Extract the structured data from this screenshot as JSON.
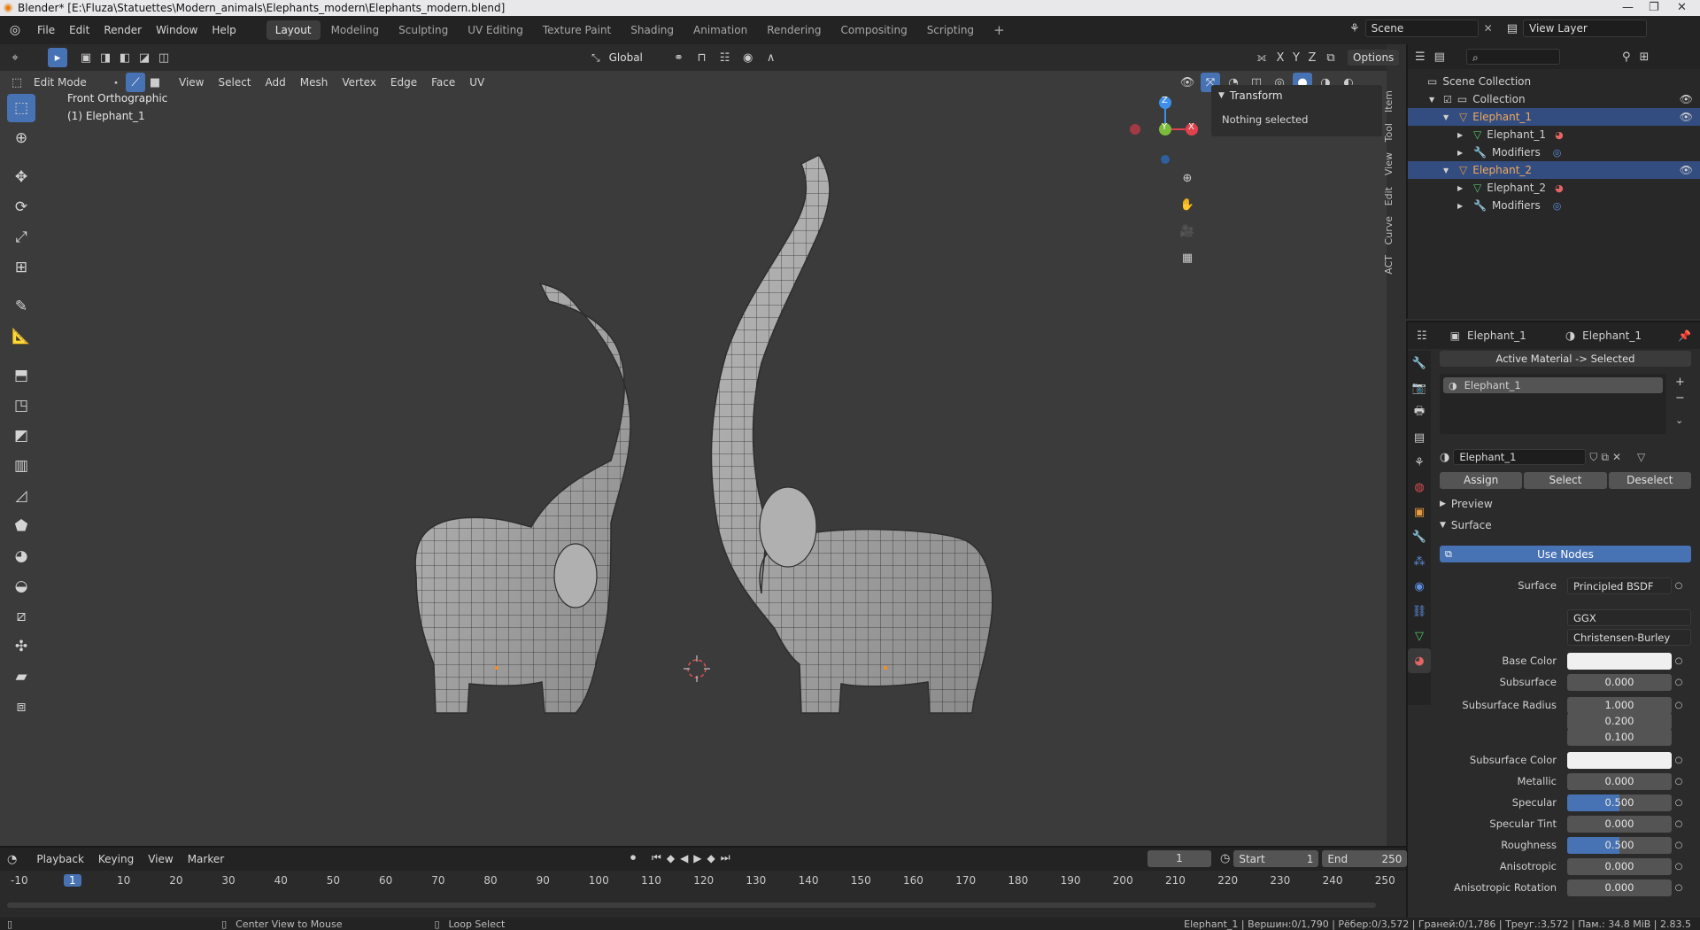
{
  "title_bar": {
    "title": "Blender* [E:\\Fluza\\Statuettes\\Modern_animals\\Elephants_modern\\Elephants_modern.blend]"
  },
  "menu": {
    "items": [
      "File",
      "Edit",
      "Render",
      "Window",
      "Help"
    ]
  },
  "workspaces": {
    "tabs": [
      "Layout",
      "Modeling",
      "Sculpting",
      "UV Editing",
      "Texture Paint",
      "Shading",
      "Animation",
      "Rendering",
      "Compositing",
      "Scripting"
    ],
    "active": "Layout",
    "add": "+"
  },
  "scene": {
    "label": "Scene",
    "view_layer": "View Layer"
  },
  "viewport_header": {
    "mode": "Edit Mode",
    "menus": [
      "View",
      "Select",
      "Add",
      "Mesh",
      "Vertex",
      "Edge",
      "Face",
      "UV"
    ],
    "orientation": "Global",
    "options": "Options",
    "axes": [
      "X",
      "Y",
      "Z"
    ]
  },
  "viewport": {
    "view_name": "Front Orthographic",
    "object_name": "(1) Elephant_1",
    "gizmo": {
      "x": "X",
      "y": "Y",
      "z": "Z"
    }
  },
  "npanel": {
    "section": "Transform",
    "message": "Nothing selected",
    "tabs": [
      "Item",
      "Tool",
      "View",
      "Edit",
      "Curve",
      "ACT"
    ]
  },
  "outliner": {
    "root": "Scene Collection",
    "rows": [
      {
        "label": "Collection",
        "level": 1,
        "selected": false
      },
      {
        "label": "Elephant_1",
        "level": 2,
        "selected": true
      },
      {
        "label": "Elephant_1",
        "level": 3,
        "selected": false
      },
      {
        "label": "Modifiers",
        "level": 3,
        "selected": false
      },
      {
        "label": "Elephant_2",
        "level": 2,
        "selected": true
      },
      {
        "label": "Elephant_2",
        "level": 3,
        "selected": false
      },
      {
        "label": "Modifiers",
        "level": 3,
        "selected": false
      }
    ]
  },
  "properties": {
    "object_name": "Elephant_1",
    "material_name_header": "Elephant_1",
    "active_material_button": "Active Material -> Selected",
    "slot": "Elephant_1",
    "material_field": "Elephant_1",
    "assign": "Assign",
    "select": "Select",
    "deselect": "Deselect",
    "preview": "Preview",
    "surface_section": "Surface",
    "use_nodes": "Use Nodes",
    "surface_label": "Surface",
    "surface_value": "Principled BSDF",
    "distribution": "GGX",
    "subsurface_method": "Christensen-Burley",
    "fields": [
      {
        "label": "Base Color",
        "type": "color",
        "color": "#f0f0f0"
      },
      {
        "label": "Subsurface",
        "value": "0.000",
        "fraction": 0
      },
      {
        "label": "Subsurface Radius",
        "value": "1.000",
        "fraction": 0
      },
      {
        "label": "",
        "value": "0.200",
        "fraction": 0
      },
      {
        "label": "",
        "value": "0.100",
        "fraction": 0
      },
      {
        "label": "Subsurface Color",
        "type": "color",
        "color": "#f0f0f0"
      },
      {
        "label": "Metallic",
        "value": "0.000",
        "fraction": 0
      },
      {
        "label": "Specular",
        "value": "0.500",
        "fraction": 0.5
      },
      {
        "label": "Specular Tint",
        "value": "0.000",
        "fraction": 0
      },
      {
        "label": "Roughness",
        "value": "0.500",
        "fraction": 0.5
      },
      {
        "label": "Anisotropic",
        "value": "0.000",
        "fraction": 0
      },
      {
        "label": "Anisotropic Rotation",
        "value": "0.000",
        "fraction": 0
      }
    ]
  },
  "timeline": {
    "menus": [
      "Playback",
      "Keying",
      "View",
      "Marker"
    ],
    "current_frame": "1",
    "start_label": "Start",
    "start": "1",
    "end_label": "End",
    "end": "250",
    "ticks": [
      "-10",
      "1",
      "10",
      "20",
      "30",
      "40",
      "50",
      "60",
      "70",
      "80",
      "90",
      "100",
      "110",
      "120",
      "130",
      "140",
      "150",
      "160",
      "170",
      "180",
      "190",
      "200",
      "210",
      "220",
      "230",
      "240",
      "250"
    ]
  },
  "statusbar": {
    "center_view": "Center View to Mouse",
    "loop_select": "Loop Select",
    "stats": "Elephant_1 | Вершин:0/1,790 | Рёбер:0/3,572 | Граней:0/1,786 | Треуг.:3,572 | Пам.: 34.8 MiB | 2.83.5"
  },
  "colors": {
    "accent": "#4772b3",
    "selected_row": "#334d80",
    "x_axis": "#e0424d",
    "y_axis": "#7bbd3a",
    "z_axis": "#3f8fe8"
  }
}
